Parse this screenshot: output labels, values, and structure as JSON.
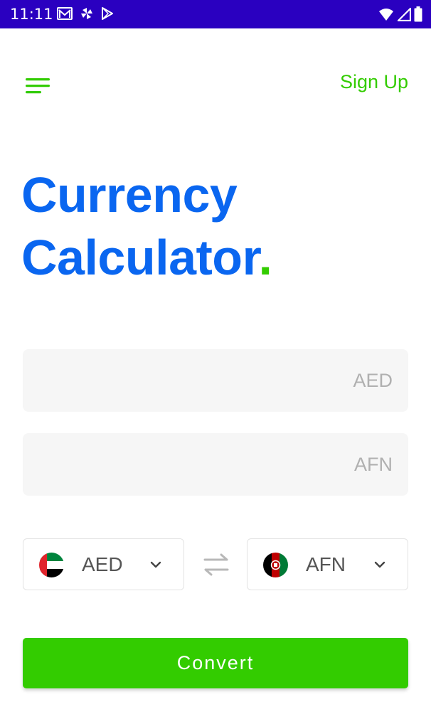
{
  "status_bar": {
    "time": "11:11",
    "background": "#2a00c0",
    "left_icons": [
      "gmail-icon",
      "pinwheel-icon",
      "play-store-icon"
    ],
    "right_icons": [
      "wifi-icon",
      "signal-icon",
      "battery-icon"
    ]
  },
  "header": {
    "menu_icon": "hamburger-menu-icon",
    "sign_up_label": "Sign Up"
  },
  "title": {
    "line1": "Currency",
    "line2": "Calculator",
    "dot": "."
  },
  "fields": {
    "from": {
      "value": "",
      "placeholder": "AED"
    },
    "to": {
      "value": "",
      "placeholder": "AFN"
    }
  },
  "selectors": {
    "from": {
      "code": "AED",
      "flag": "uae-flag-icon"
    },
    "to": {
      "code": "AFN",
      "flag": "afghanistan-flag-icon"
    },
    "swap_icon": "swap-arrows-icon"
  },
  "convert_label": "Convert",
  "colors": {
    "primary_blue": "#0a66f0",
    "accent_green": "#33cc00",
    "field_bg": "#f6f6f6"
  }
}
